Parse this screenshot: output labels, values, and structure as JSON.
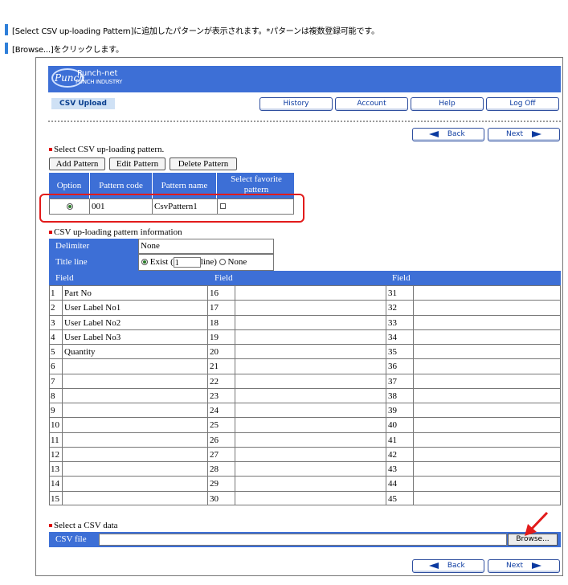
{
  "instructions": [
    "[Select CSV up-loading Pattern]に追加したパターンが表示されます。*パターンは複数登録可能です。",
    "[Browse...]をクリックします。"
  ],
  "app": {
    "logo_mark": "Punch",
    "logo_line1": "Punch-net",
    "logo_line2": "PUNCH INDUSTRY",
    "page_tag": "CSV Upload",
    "menu": {
      "history": "History",
      "account": "Account",
      "help": "Help",
      "logoff": "Log Off"
    },
    "nav": {
      "back": "Back",
      "next": "Next"
    }
  },
  "pattern": {
    "title": "Select CSV up-loading pattern.",
    "buttons": {
      "add": "Add Pattern",
      "edit": "Edit Pattern",
      "delete": "Delete Pattern"
    },
    "columns": {
      "option": "Option",
      "code": "Pattern code",
      "name": "Pattern name",
      "favorite": "Select favorite pattern"
    },
    "row": {
      "selected": true,
      "code": "001",
      "name": "CsvPattern1",
      "favorite": false
    }
  },
  "info": {
    "title": "CSV up-loading pattern information",
    "delimiter_label": "Delimiter",
    "delimiter_value": "None",
    "title_line_label": "Title line",
    "exist_label": "Exist (",
    "exist_value": "1",
    "line_label": "line)",
    "none_label": "None"
  },
  "fields": {
    "header": "Field",
    "col1": [
      {
        "n": "1",
        "v": "Part No"
      },
      {
        "n": "2",
        "v": "User Label No1"
      },
      {
        "n": "3",
        "v": "User Label No2"
      },
      {
        "n": "4",
        "v": "User Label No3"
      },
      {
        "n": "5",
        "v": "Quantity"
      },
      {
        "n": "6",
        "v": ""
      },
      {
        "n": "7",
        "v": ""
      },
      {
        "n": "8",
        "v": ""
      },
      {
        "n": "9",
        "v": ""
      },
      {
        "n": "10",
        "v": ""
      },
      {
        "n": "11",
        "v": ""
      },
      {
        "n": "12",
        "v": ""
      },
      {
        "n": "13",
        "v": ""
      },
      {
        "n": "14",
        "v": ""
      },
      {
        "n": "15",
        "v": ""
      }
    ],
    "col2": [
      "16",
      "17",
      "18",
      "19",
      "20",
      "21",
      "22",
      "23",
      "24",
      "25",
      "26",
      "27",
      "28",
      "29",
      "30"
    ],
    "col3": [
      "31",
      "32",
      "33",
      "34",
      "35",
      "36",
      "37",
      "38",
      "39",
      "40",
      "41",
      "42",
      "43",
      "44",
      "45"
    ]
  },
  "csv": {
    "title": "Select a CSV data",
    "label": "CSV file",
    "value": "",
    "browse": "Browse..."
  },
  "colors": {
    "header_blue": "#3d6fd6",
    "highlight_red": "#e21b1b",
    "link_blue": "#0b3aa0"
  }
}
